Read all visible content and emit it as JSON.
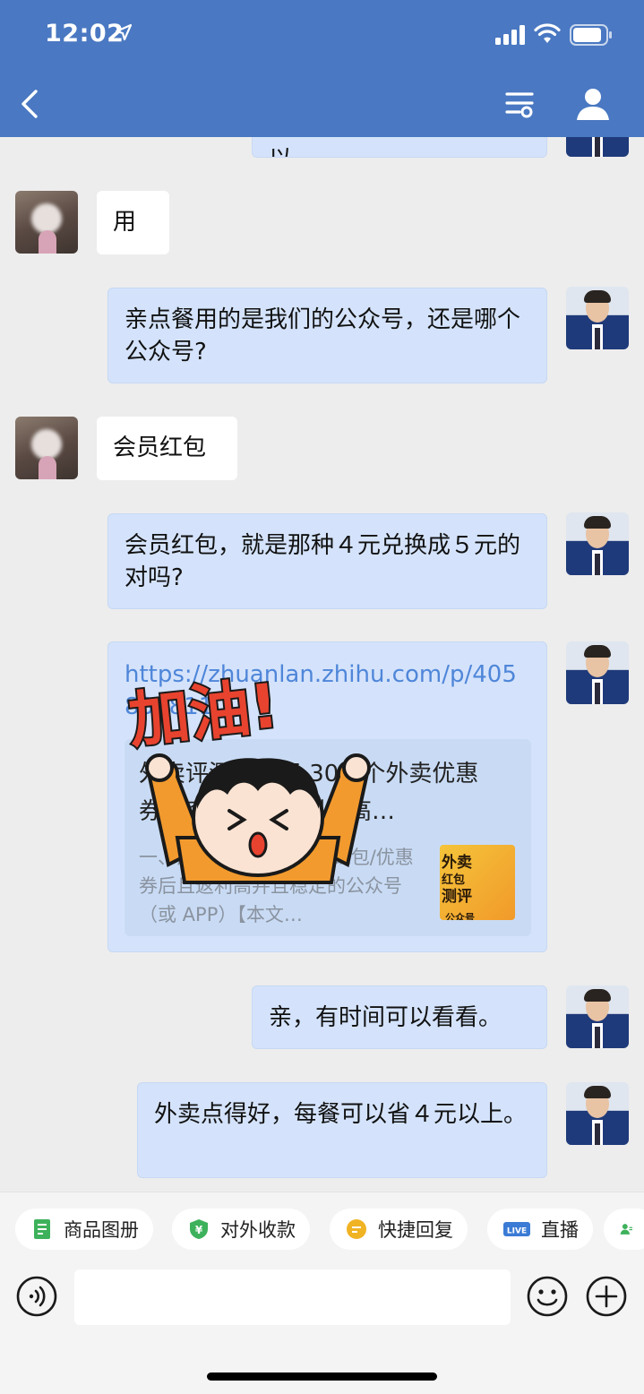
{
  "status_bar": {
    "time": "12:02"
  },
  "messages": {
    "m0": "亲，如果有需要的话也可以",
    "m1": "用",
    "m2": "亲点餐用的是我们的公众号，还是哪个公众号?",
    "m3": "会员红包",
    "m4": "会员红包，就是那种４元兑换成５元的对吗?",
    "m5_url": "https://zhuanlan.zhihu.com/p/405830811",
    "m5_card_title": "外卖评测：测了 30多个外卖优惠券，究竟哪家返利最高…",
    "m5_card_desc": "一、测评了30多个外卖红包/优惠券后且返利高并且稳定的公众号（或 APP）【本文…",
    "m5_thumb_text": [
      "外卖",
      "红包",
      "测评",
      "公众号"
    ],
    "m6": "亲，有时间可以看看。",
    "m7": "外卖点得好，每餐可以省４元以上。"
  },
  "sticker_text": "加油!",
  "quick_actions": [
    {
      "label": "商品图册",
      "icon": "album-icon",
      "color": "#3db15b"
    },
    {
      "label": "对外收款",
      "icon": "payment-shield-icon",
      "color": "#3db15b"
    },
    {
      "label": "快捷回复",
      "icon": "quick-reply-icon",
      "color": "#f0b323"
    },
    {
      "label": "直播",
      "icon": "live-icon",
      "color": "#3a7bd5"
    },
    {
      "label": "",
      "icon": "contact-icon",
      "color": "#3db15b"
    }
  ],
  "colors": {
    "header": "#4a78c2",
    "my_bubble": "#d4e3fb",
    "link": "#4f86d9"
  }
}
